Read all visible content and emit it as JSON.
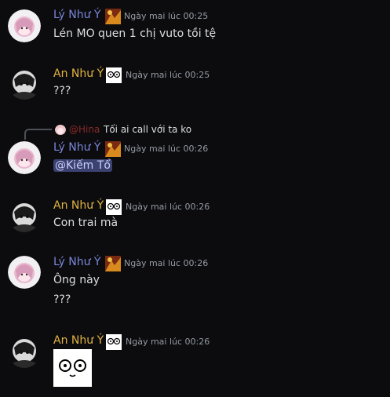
{
  "colors": {
    "ly_name": "#7b86d9",
    "an_name": "#e3b341",
    "hina_name": "#8a2a2a",
    "mention_bg": "#3c4270",
    "background": "#0c0c0e"
  },
  "messages": [
    {
      "author": "Lý Như Ý",
      "timestamp": "Ngày mai lúc 00:25",
      "text": "Lén MO quen 1 chị vuto tồi tệ"
    },
    {
      "author": "An Như Ý",
      "timestamp": "Ngày mai lúc 00:25",
      "text": "???"
    },
    {
      "author": "Lý Như Ý",
      "timestamp": "Ngày mai lúc 00:26",
      "reply": {
        "author": "@Hina",
        "text": "Tối ai call với ta ko"
      },
      "mention": "@Kiếm Tổ"
    },
    {
      "author": "An Như Ý",
      "timestamp": "Ngày mai lúc 00:26",
      "text": "Con trai mà"
    },
    {
      "author": "Lý Như Ý",
      "timestamp": "Ngày mai lúc 00:26",
      "lines": [
        "Ông này",
        "???"
      ]
    },
    {
      "author": "An Như Ý",
      "timestamp": "Ngày mai lúc 00:26",
      "attachment": "sticker-face"
    }
  ]
}
